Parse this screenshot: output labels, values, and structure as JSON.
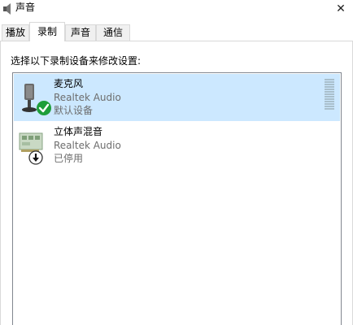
{
  "window": {
    "title": "声音",
    "close_glyph": "✕",
    "icon": "speaker-icon"
  },
  "tabs": [
    {
      "label": "播放",
      "active": false
    },
    {
      "label": "录制",
      "active": true
    },
    {
      "label": "声音",
      "active": false
    },
    {
      "label": "通信",
      "active": false
    }
  ],
  "content": {
    "instruction": "选择以下录制设备来修改设置:",
    "devices": [
      {
        "name": "麦克风",
        "driver": "Realtek Audio",
        "status": "默认设备",
        "selected": true,
        "icon": "microphone-icon",
        "badge": "check-default-icon",
        "badge_color": "#1e9e3a",
        "level_bars": 13
      },
      {
        "name": "立体声混音",
        "driver": "Realtek Audio",
        "status": "已停用",
        "selected": false,
        "icon": "sound-card-icon",
        "badge": "disabled-arrow-icon",
        "badge_color": "#ffffff"
      }
    ]
  },
  "colors": {
    "selection": "#cce8ff",
    "list_border": "#828790",
    "secondary_text": "#6d6d6d"
  }
}
